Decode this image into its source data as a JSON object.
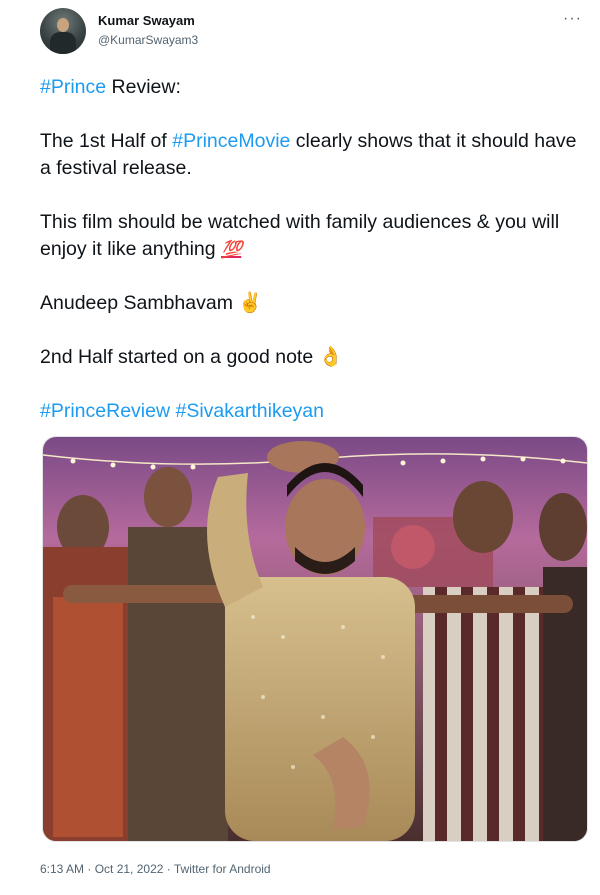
{
  "author": {
    "name": "Kumar Swayam",
    "handle": "@KumarSwayam3"
  },
  "menu_glyph": "···",
  "tweet": {
    "line1": {
      "tag": "#Prince",
      "text": " Review:"
    },
    "line2": {
      "pre": "The 1st Half of ",
      "tag": "#PrinceMovie",
      "post": " clearly shows that it should have a festival release."
    },
    "line3": {
      "text": "This film should be watched with family audiences & you will enjoy it like anything ",
      "emoji": "💯"
    },
    "line4": {
      "text": "Anudeep Sambhavam ",
      "emoji": "✌️"
    },
    "line5": {
      "text": "2nd Half started on a good note ",
      "emoji": "👌"
    },
    "line6": {
      "tag1": "#PrinceReview",
      "sep": " ",
      "tag2": "#Sivakarthikeyan"
    }
  },
  "media": {
    "description_icon": "photo-icon"
  },
  "footer": {
    "time": "6:13 AM",
    "sep1": " · ",
    "date": "Oct 21, 2022",
    "sep2": " · ",
    "source": "Twitter for Android"
  },
  "colors": {
    "link": "#1d9bf0",
    "text": "#0f1419",
    "secondary": "#536471"
  }
}
